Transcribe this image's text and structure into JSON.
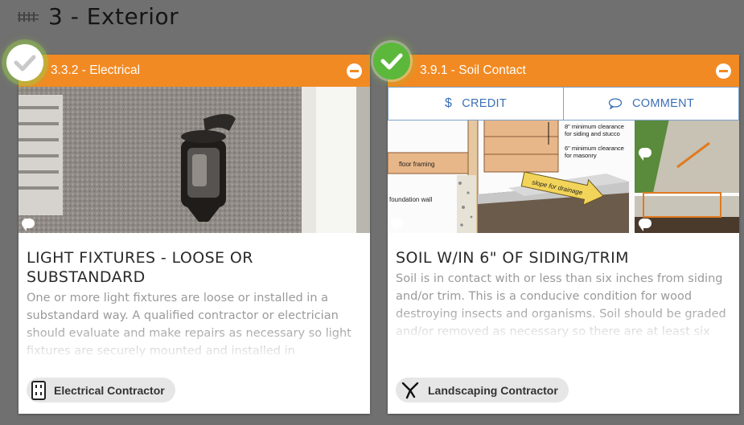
{
  "section": {
    "title": "3 - Exterior",
    "icon": "fence-icon"
  },
  "cards": [
    {
      "code": "3.3.2 - Electrical",
      "checked": false,
      "title": "LIGHT FIXTURES - LOOSE OR SUBSTANDARD",
      "description": "One or more light fixtures are loose or installed in a substandard way. A qualified contractor or electrician should evaluate and make repairs as necessary so light fixtures are securely mounted and installed in accordance with general safety standards.",
      "contractor": {
        "label": "Electrical Contractor",
        "icon": "outlet-icon"
      }
    },
    {
      "code": "3.9.1 - Soil Contact",
      "checked": true,
      "title": "SOIL W/IN 6\" OF SIDING/TRIM",
      "description": "Soil is in contact with or less than six inches from siding and/or trim. This is a conducive condition for wood destroying insects and organisms. Soil should be graded and/or removed as necessary so there are at least six inches of space between the siding and trim and the soil below.",
      "contractor": {
        "label": "Landscaping Contractor",
        "icon": "shears-icon"
      },
      "actions": {
        "credit": "CREDIT",
        "comment": "COMMENT"
      },
      "diagram": {
        "clearance_siding": "8\" minimum clearance for siding and stucco",
        "clearance_masonry": "6\" minimum clearance for masonry",
        "floor_framing": "floor framing",
        "foundation_wall": "foundation wall",
        "slope": "slope for drainage"
      }
    }
  ],
  "colors": {
    "header": "#f28a23",
    "check": "#5cb83a",
    "link": "#3b6fb6",
    "background": "#707070"
  }
}
